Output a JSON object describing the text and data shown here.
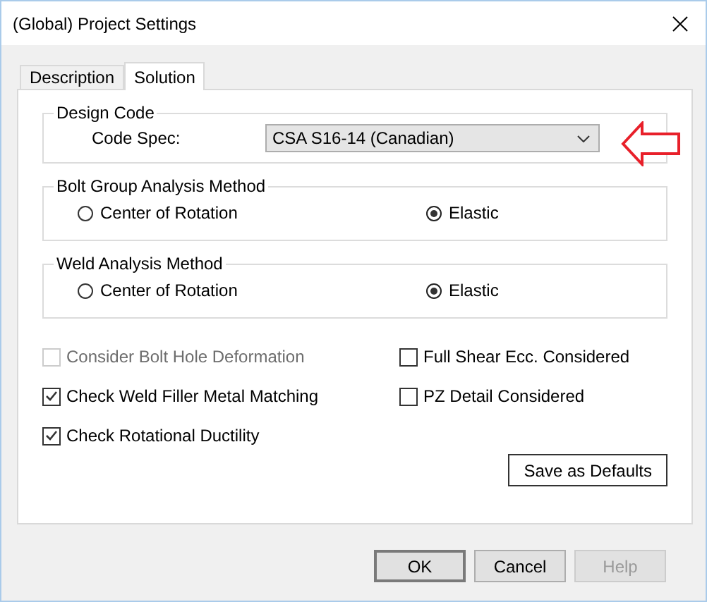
{
  "window": {
    "title": "(Global) Project Settings"
  },
  "tabs": [
    {
      "label": "Description",
      "selected": false
    },
    {
      "label": "Solution",
      "selected": true
    }
  ],
  "design_code": {
    "legend": "Design Code",
    "label": "Code Spec:",
    "value": "CSA S16-14 (Canadian)"
  },
  "radio_groups": [
    {
      "legend": "Bolt Group Analysis Method",
      "options": [
        {
          "label": "Center of Rotation",
          "selected": false
        },
        {
          "label": "Elastic",
          "selected": true
        }
      ]
    },
    {
      "legend": "Weld Analysis Method",
      "options": [
        {
          "label": "Center of Rotation",
          "selected": false
        },
        {
          "label": "Elastic",
          "selected": true
        }
      ]
    }
  ],
  "checkboxes_left": [
    {
      "label": "Consider Bolt Hole Deformation",
      "checked": false,
      "disabled": true
    },
    {
      "label": "Check Weld Filler Metal Matching",
      "checked": true,
      "disabled": false
    },
    {
      "label": "Check Rotational Ductility",
      "checked": true,
      "disabled": false
    }
  ],
  "checkboxes_right": [
    {
      "label": "Full Shear Ecc. Considered",
      "checked": false,
      "disabled": false
    },
    {
      "label": "PZ Detail Considered",
      "checked": false,
      "disabled": false
    }
  ],
  "save_button": "Save as Defaults",
  "dialog_buttons": [
    {
      "label": "OK",
      "default": true,
      "disabled": false
    },
    {
      "label": "Cancel",
      "default": false,
      "disabled": false
    },
    {
      "label": "Help",
      "default": false,
      "disabled": true
    }
  ]
}
